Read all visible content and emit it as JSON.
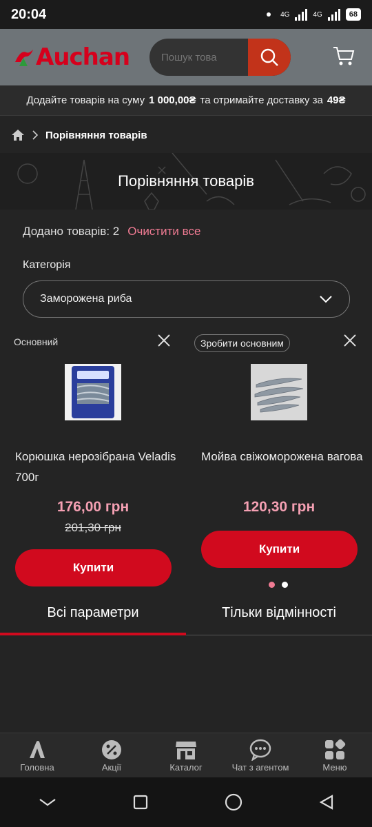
{
  "status": {
    "time": "20:04",
    "net1": "4G",
    "net2": "4G",
    "battery": "68"
  },
  "header": {
    "logo": "Auchan",
    "search_placeholder": "Пошук това"
  },
  "promo": {
    "text1": "Додайте товарів на суму",
    "amount": "1 000,00₴",
    "text2": "та отримайте доставку за",
    "fee": "49₴"
  },
  "breadcrumb": {
    "current": "Порівняння товарів"
  },
  "banner": {
    "title": "Порівняння товарів"
  },
  "summary": {
    "added": "Додано товарів: 2",
    "clear": "Очистити все"
  },
  "category": {
    "label": "Категорія",
    "selected": "Заморожена риба"
  },
  "products": [
    {
      "tag": "Основний",
      "name": "Корюшка нерозібрана Veladis 700г",
      "price": "176,00 грн",
      "old_price": "201,30 грн",
      "buy": "Купити"
    },
    {
      "tag": "Зробити основним",
      "name": "Мойва свіжоморожена вагова",
      "price": "120,30 грн",
      "buy": "Купити"
    }
  ],
  "tabs": {
    "all": "Всі параметри",
    "diff": "Тільки відмінності"
  },
  "bottom_nav": [
    {
      "label": "Головна",
      "icon": "home-icon"
    },
    {
      "label": "Акції",
      "icon": "discount-icon"
    },
    {
      "label": "Каталог",
      "icon": "store-icon"
    },
    {
      "label": "Чат з агентом",
      "icon": "chat-icon"
    },
    {
      "label": "Меню",
      "icon": "menu-icon"
    }
  ],
  "colors": {
    "accent": "#d10a1e",
    "price": "#f5a0b3",
    "clear": "#f07b93",
    "header": "#6e7478"
  }
}
